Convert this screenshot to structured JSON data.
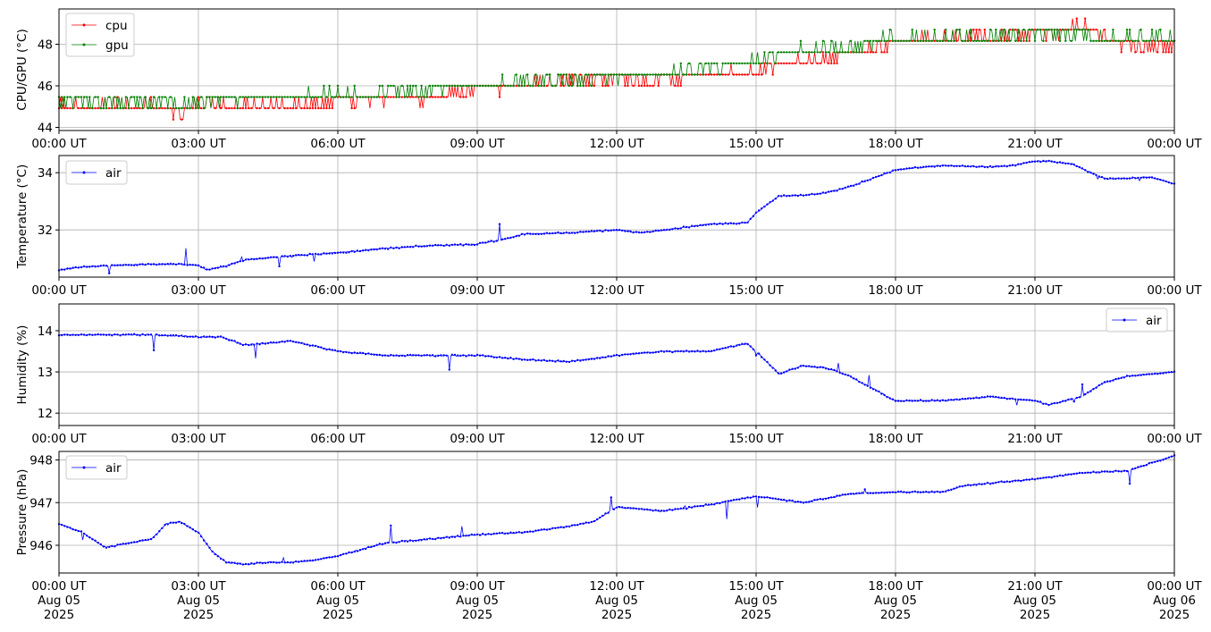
{
  "chart_data": [
    {
      "type": "line",
      "ylabel": "CPU/GPU (°C)",
      "ylim": [
        43.85,
        49.7
      ],
      "yticks": [
        44,
        46,
        48
      ],
      "grid": true,
      "legend_position": "top-left",
      "x_tick_labels": [
        "00:00 UT",
        "03:00 UT",
        "06:00 UT",
        "09:00 UT",
        "12:00 UT",
        "15:00 UT",
        "18:00 UT",
        "21:00 UT",
        "00:00 UT"
      ],
      "x_hours": [
        0,
        3,
        6,
        9,
        12,
        15,
        18,
        21,
        24
      ],
      "series": [
        {
          "name": "cpu",
          "color": "#ff0000",
          "hours": [
            0,
            1,
            2,
            2.5,
            3,
            4,
            5,
            6,
            7,
            8,
            9,
            10,
            11,
            12,
            13,
            14,
            15,
            15.5,
            16,
            17,
            18,
            19,
            20,
            21,
            22,
            23,
            24
          ],
          "values": [
            45.0,
            45.0,
            45.0,
            44.5,
            45.0,
            45.0,
            45.0,
            45.1,
            45.3,
            45.4,
            45.8,
            46.0,
            46.2,
            46.2,
            46.2,
            46.4,
            46.6,
            47.0,
            47.1,
            47.4,
            48.0,
            48.2,
            48.3,
            48.4,
            48.8,
            47.8,
            47.8
          ]
        },
        {
          "name": "gpu",
          "color": "#008000",
          "hours": [
            0,
            1,
            2,
            3,
            4,
            5,
            6,
            7,
            8,
            9,
            10,
            11,
            12,
            13,
            14,
            15,
            15.5,
            16,
            17,
            18,
            19,
            20,
            21,
            22,
            23,
            24
          ],
          "values": [
            45.1,
            45.1,
            45.1,
            45.1,
            45.3,
            45.4,
            45.5,
            45.6,
            45.7,
            45.9,
            46.1,
            46.2,
            46.3,
            46.5,
            46.8,
            47.1,
            47.4,
            47.6,
            47.8,
            48.2,
            48.3,
            48.3,
            48.4,
            48.3,
            48.2,
            48.3
          ]
        }
      ]
    },
    {
      "type": "line",
      "ylabel": "Temperature (°C)",
      "ylim": [
        30.35,
        34.6
      ],
      "yticks": [
        32,
        34
      ],
      "grid": true,
      "legend_position": "top-left",
      "x_tick_labels": [
        "00:00 UT",
        "03:00 UT",
        "06:00 UT",
        "09:00 UT",
        "12:00 UT",
        "15:00 UT",
        "18:00 UT",
        "21:00 UT",
        "00:00 UT"
      ],
      "x_hours": [
        0,
        3,
        6,
        9,
        12,
        15,
        18,
        21,
        24
      ],
      "series": [
        {
          "name": "air",
          "color": "#0000ff",
          "hours": [
            0,
            0.5,
            1,
            2,
            2.7,
            3.0,
            3.2,
            3.5,
            4,
            5,
            6,
            7,
            8,
            9,
            9.5,
            10,
            11,
            12,
            12.5,
            13,
            14,
            14.8,
            15,
            15.5,
            16,
            16.5,
            17,
            17.5,
            18,
            19,
            20,
            20.5,
            21,
            21.3,
            21.8,
            22.2,
            22.5,
            23,
            23.5,
            24
          ],
          "values": [
            30.6,
            30.7,
            30.75,
            30.8,
            30.8,
            30.75,
            30.6,
            30.7,
            30.95,
            31.1,
            31.2,
            31.35,
            31.45,
            31.5,
            31.65,
            31.85,
            31.9,
            32.0,
            31.9,
            32.0,
            32.2,
            32.25,
            32.6,
            33.2,
            33.2,
            33.3,
            33.5,
            33.8,
            34.1,
            34.25,
            34.2,
            34.25,
            34.4,
            34.4,
            34.3,
            34.0,
            33.8,
            33.8,
            33.85,
            33.6
          ]
        }
      ]
    },
    {
      "type": "line",
      "ylabel": "Humidity (%)",
      "ylim": [
        11.7,
        14.65
      ],
      "yticks": [
        12,
        13,
        14
      ],
      "grid": true,
      "legend_position": "top-right",
      "x_tick_labels": [
        "00:00 UT",
        "03:00 UT",
        "06:00 UT",
        "09:00 UT",
        "12:00 UT",
        "15:00 UT",
        "18:00 UT",
        "21:00 UT",
        "00:00 UT"
      ],
      "x_hours": [
        0,
        3,
        6,
        9,
        12,
        15,
        18,
        21,
        24
      ],
      "series": [
        {
          "name": "air",
          "color": "#0000ff",
          "hours": [
            0,
            1,
            2,
            3,
            3.5,
            4,
            4.5,
            5,
            6,
            7,
            8,
            9,
            10,
            11,
            12,
            13,
            14,
            14.8,
            15,
            15.5,
            16,
            16.5,
            17,
            17.5,
            18,
            19,
            20,
            21,
            21.3,
            22,
            22.5,
            23,
            24
          ],
          "values": [
            13.9,
            13.9,
            13.9,
            13.85,
            13.85,
            13.65,
            13.7,
            13.75,
            13.5,
            13.4,
            13.4,
            13.4,
            13.3,
            13.25,
            13.4,
            13.5,
            13.5,
            13.7,
            13.5,
            12.95,
            13.15,
            13.1,
            12.9,
            12.6,
            12.3,
            12.3,
            12.4,
            12.3,
            12.2,
            12.4,
            12.75,
            12.9,
            13.0
          ]
        }
      ]
    },
    {
      "type": "line",
      "ylabel": "Pressure (hPa)",
      "ylim": [
        945.35,
        948.2
      ],
      "yticks": [
        946,
        947,
        948
      ],
      "grid": true,
      "legend_position": "top-left",
      "x_tick_labels": [
        "00:00 UT\nAug 05\n2025",
        "03:00 UT\nAug 05\n2025",
        "06:00 UT\nAug 05\n2025",
        "09:00 UT\nAug 05\n2025",
        "12:00 UT\nAug 05\n2025",
        "15:00 UT\nAug 05\n2025",
        "18:00 UT\nAug 05\n2025",
        "21:00 UT\nAug 05\n2025",
        "00:00 UT\nAug 06\n2025"
      ],
      "x_hours": [
        0,
        3,
        6,
        9,
        12,
        15,
        18,
        21,
        24
      ],
      "series": [
        {
          "name": "air",
          "color": "#0000ff",
          "hours": [
            0,
            0.5,
            1,
            1.5,
            2,
            2.3,
            2.6,
            3,
            3.3,
            3.6,
            4,
            4.5,
            5,
            5.5,
            6,
            6.5,
            7,
            8,
            9,
            10,
            11,
            11.5,
            12,
            13,
            14,
            15,
            16,
            17,
            18,
            19,
            19.5,
            20,
            21,
            22,
            23,
            24
          ],
          "values": [
            946.5,
            946.3,
            945.95,
            946.05,
            946.15,
            946.5,
            946.55,
            946.3,
            945.85,
            945.6,
            945.55,
            945.6,
            945.6,
            945.65,
            945.75,
            945.9,
            946.05,
            946.15,
            946.25,
            946.3,
            946.45,
            946.55,
            946.9,
            946.8,
            946.95,
            947.15,
            947.0,
            947.2,
            947.25,
            947.25,
            947.4,
            947.45,
            947.55,
            947.7,
            947.75,
            948.1
          ]
        }
      ]
    }
  ]
}
